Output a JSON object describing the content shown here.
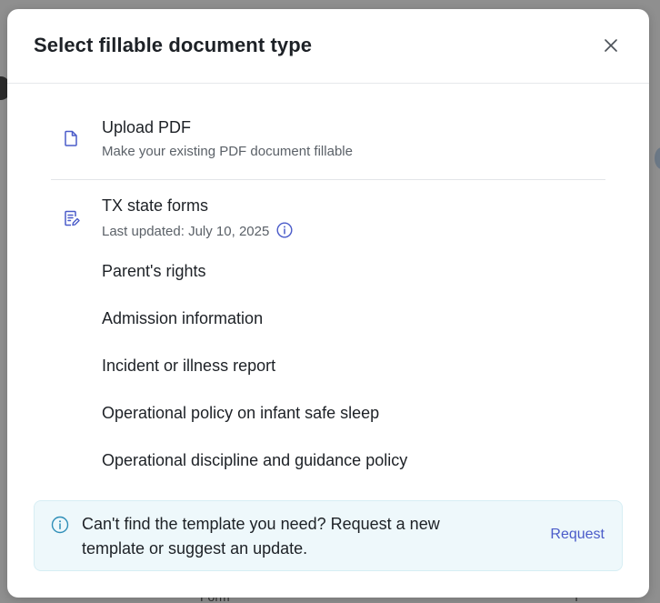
{
  "modal": {
    "title": "Select fillable document type",
    "close_icon": "close-icon"
  },
  "upload_option": {
    "icon": "document-icon",
    "title": "Upload PDF",
    "subtitle": "Make your existing PDF document fillable"
  },
  "state_forms": {
    "icon": "edit-document-icon",
    "title": "TX state forms",
    "last_updated": "Last updated: July 10, 2025",
    "info_icon": "info-icon",
    "forms": [
      "Parent's rights",
      "Admission information",
      "Incident or illness report",
      "Operational policy on infant safe sleep",
      "Operational discipline and guidance policy"
    ]
  },
  "banner": {
    "icon": "info-icon",
    "text": "Can't find the template you need? Request a new template or suggest an update.",
    "link_label": "Request"
  },
  "background": {
    "bottom_left_text": "Form",
    "bottom_right_text": "I"
  },
  "colors": {
    "accent": "#4a5bc9",
    "banner_bg": "#eef8fb",
    "overlay": "#8f8f8f"
  }
}
